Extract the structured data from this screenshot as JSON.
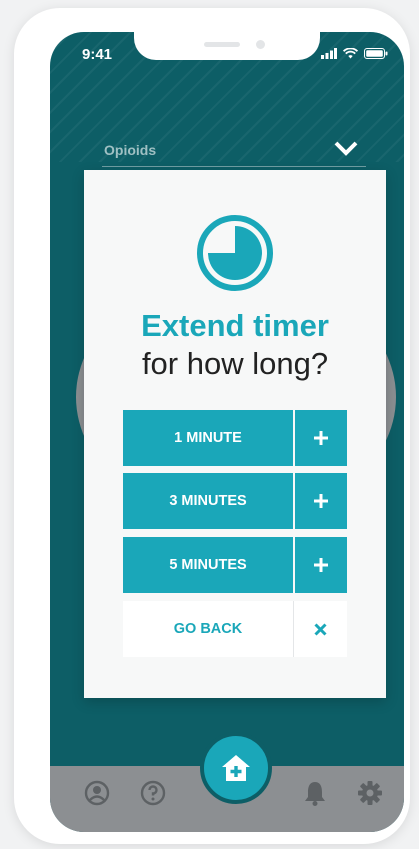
{
  "status_bar": {
    "time": "9:41"
  },
  "background_field": {
    "label": "Opioids"
  },
  "modal": {
    "title": "Extend timer",
    "subtitle": "for how long?",
    "options": [
      {
        "label": "1 MINUTE"
      },
      {
        "label": "3 MINUTES"
      },
      {
        "label": "5 MINUTES"
      }
    ],
    "back_label": "GO BACK"
  },
  "colors": {
    "accent": "#1aa7b9",
    "background": "#0d5e66",
    "tab_bar": "#8c8f92"
  },
  "tab_bar": {
    "icons": [
      "profile-icon",
      "help-icon",
      "home-plus-icon",
      "bell-icon",
      "gear-icon"
    ]
  }
}
